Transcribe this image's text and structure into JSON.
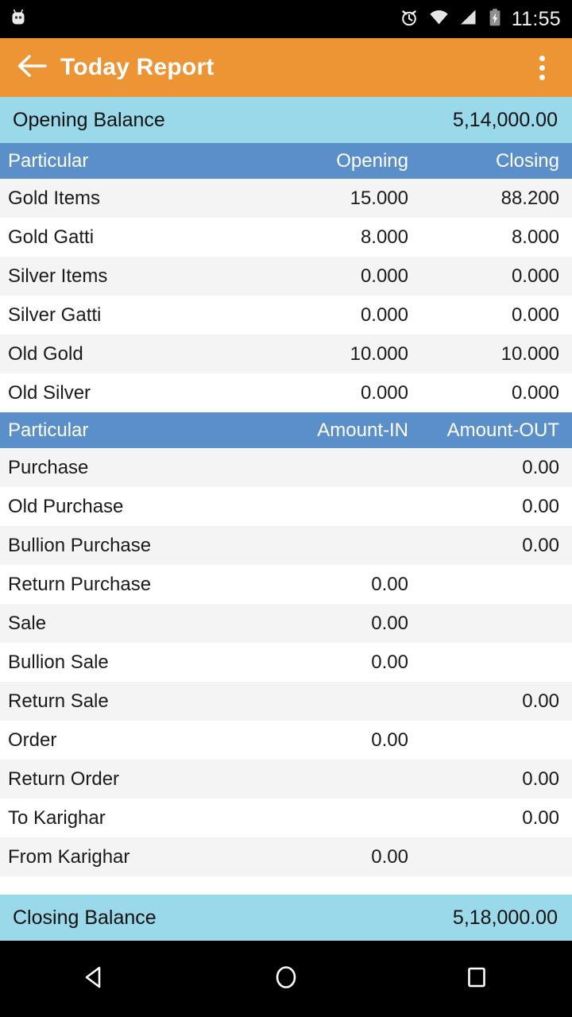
{
  "status_bar": {
    "notification_icon": "android-robot-icon",
    "icons": [
      "alarm-clock-icon",
      "wifi-icon",
      "signal-cellular-icon",
      "battery-charging-icon"
    ],
    "time": "11:55"
  },
  "toolbar": {
    "back_icon": "arrow-left-icon",
    "title": "Today Report",
    "overflow_icon": "more-vertical-icon"
  },
  "opening_balance": {
    "label": "Opening Balance",
    "value": "5,14,000.00"
  },
  "closing_balance": {
    "label": "Closing Balance",
    "value": "5,18,000.00"
  },
  "stock_table": {
    "headers": [
      "Particular",
      "Opening",
      "Closing"
    ],
    "rows": [
      {
        "particular": "Gold Items",
        "opening": "15.000",
        "closing": "88.200"
      },
      {
        "particular": "Gold Gatti",
        "opening": "8.000",
        "closing": "8.000"
      },
      {
        "particular": "Silver Items",
        "opening": "0.000",
        "closing": "0.000"
      },
      {
        "particular": "Silver Gatti",
        "opening": "0.000",
        "closing": "0.000"
      },
      {
        "particular": "Old Gold",
        "opening": "10.000",
        "closing": "10.000"
      },
      {
        "particular": "Old Silver",
        "opening": "0.000",
        "closing": "0.000"
      }
    ]
  },
  "amount_table": {
    "headers": [
      "Particular",
      "Amount-IN",
      "Amount-OUT"
    ],
    "rows": [
      {
        "particular": "Purchase",
        "amount_in": "",
        "amount_out": "0.00"
      },
      {
        "particular": "Old Purchase",
        "amount_in": "",
        "amount_out": "0.00"
      },
      {
        "particular": "Bullion Purchase",
        "amount_in": "",
        "amount_out": "0.00"
      },
      {
        "particular": "Return Purchase",
        "amount_in": "0.00",
        "amount_out": ""
      },
      {
        "particular": "Sale",
        "amount_in": "0.00",
        "amount_out": ""
      },
      {
        "particular": "Bullion Sale",
        "amount_in": "0.00",
        "amount_out": ""
      },
      {
        "particular": "Return Sale",
        "amount_in": "",
        "amount_out": "0.00"
      },
      {
        "particular": "Order",
        "amount_in": "0.00",
        "amount_out": ""
      },
      {
        "particular": "Return Order",
        "amount_in": "",
        "amount_out": "0.00"
      },
      {
        "particular": "To Karighar",
        "amount_in": "",
        "amount_out": "0.00"
      },
      {
        "particular": "From Karighar",
        "amount_in": "0.00",
        "amount_out": ""
      }
    ]
  },
  "nav_bar": {
    "buttons": [
      "back-nav-icon",
      "home-nav-icon",
      "recents-nav-icon"
    ]
  },
  "colors": {
    "toolbar": "#ed9434",
    "balance_bar": "#99d9ea",
    "table_header": "#5b8fc9",
    "row_alt": "#f4f4f4",
    "system_bar": "#000000"
  }
}
